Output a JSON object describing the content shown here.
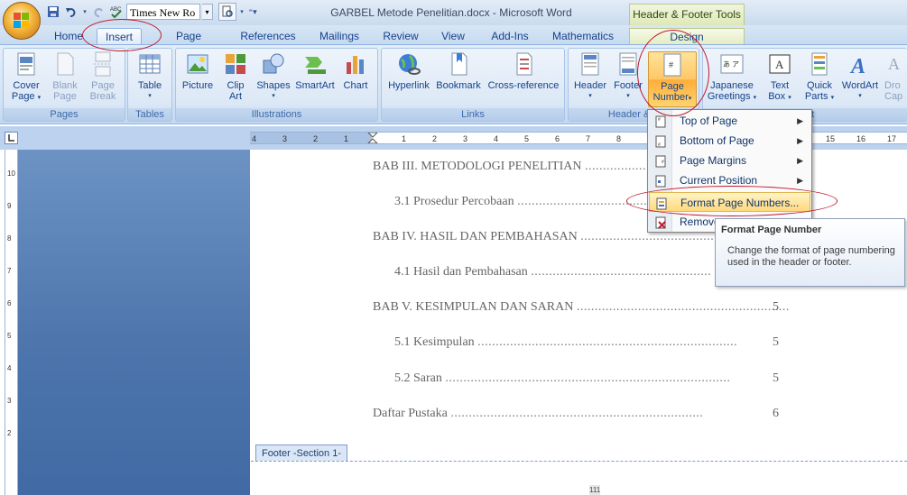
{
  "title_bar": {
    "document_title": "GARBEL Metode Penelitian.docx - Microsoft Word",
    "context_tab_group": "Header & Footer Tools"
  },
  "quick_access": {
    "font_name": "Times New Ro",
    "icons": [
      "save-icon",
      "undo-icon",
      "redo-icon",
      "spelling-icon",
      "print-preview-icon",
      "customize-icon"
    ]
  },
  "tabs": [
    "Home",
    "Insert",
    "Page Layout",
    "References",
    "Mailings",
    "Review",
    "View",
    "Add-Ins",
    "Mathematics",
    "Design"
  ],
  "active_tab": "Insert",
  "ribbon": {
    "groups": [
      {
        "label": "Pages",
        "buttons": [
          "Cover Page",
          "Blank Page",
          "Page Break"
        ]
      },
      {
        "label": "Tables",
        "buttons": [
          "Table"
        ]
      },
      {
        "label": "Illustrations",
        "buttons": [
          "Picture",
          "Clip Art",
          "Shapes",
          "SmartArt",
          "Chart"
        ]
      },
      {
        "label": "Links",
        "buttons": [
          "Hyperlink",
          "Bookmark",
          "Cross-reference"
        ]
      },
      {
        "label": "Header & F",
        "buttons": [
          "Header",
          "Footer",
          "Page Number"
        ]
      },
      {
        "label": "Text",
        "buttons": [
          "Japanese Greetings",
          "Text Box",
          "Quick Parts",
          "WordArt",
          "Dro Cap"
        ]
      }
    ],
    "btn": {
      "cover_1": "Cover",
      "cover_2": "Page",
      "blank_1": "Blank",
      "blank_2": "Page",
      "break_1": "Page",
      "break_2": "Break",
      "table": "Table",
      "picture": "Picture",
      "clipart_1": "Clip",
      "clipart_2": "Art",
      "shapes": "Shapes",
      "smartart": "SmartArt",
      "chart": "Chart",
      "hyperlink": "Hyperlink",
      "bookmark": "Bookmark",
      "crossref": "Cross-reference",
      "header": "Header",
      "footer": "Footer",
      "pagenum_1": "Page",
      "pagenum_2": "Number",
      "japanese_1": "Japanese",
      "japanese_2": "Greetings",
      "textbox_1": "Text",
      "textbox_2": "Box",
      "quickparts_1": "Quick",
      "quickparts_2": "Parts",
      "wordart": "WordArt",
      "dropcap_1": "Dro",
      "dropcap_2": "Cap"
    }
  },
  "ruler": {
    "ticks": [
      "4",
      "3",
      "2",
      "1",
      "1",
      "2",
      "3",
      "4",
      "5",
      "6",
      "7",
      "8",
      "15",
      "16",
      "17"
    ]
  },
  "vertical_ruler": {
    "ticks": [
      "10",
      "9",
      "8",
      "7",
      "6",
      "5",
      "4",
      "3",
      "2"
    ]
  },
  "document": {
    "toc": [
      {
        "text": "BAB III. METODOLOGI PENELITIAN",
        "page": ""
      },
      {
        "text": "3.1 Prosedur Percobaan",
        "page": ""
      },
      {
        "text": "BAB IV. HASIL DAN PEMBAHASAN",
        "page": ""
      },
      {
        "text": "4.1 Hasil dan Pembahasan",
        "page": ""
      },
      {
        "text": "BAB V. KESIMPULAN DAN SARAN",
        "page": "5"
      },
      {
        "text": "5.1 Kesimpulan",
        "page": "5"
      },
      {
        "text": "5.2 Saran",
        "page": "5"
      },
      {
        "text": "Daftar Pustaka",
        "page": "6"
      }
    ],
    "footer_label": "Footer -Section 1-",
    "page_field": "111"
  },
  "menu": {
    "items": [
      {
        "label": "Top of Page",
        "icon": "top-of-page-icon",
        "submenu": true
      },
      {
        "label": "Bottom of Page",
        "icon": "bottom-of-page-icon",
        "submenu": true
      },
      {
        "label": "Page Margins",
        "icon": "page-margins-icon",
        "submenu": true
      },
      {
        "label": "Current Position",
        "icon": "current-position-icon",
        "submenu": true
      },
      {
        "label": "Format Page Numbers...",
        "icon": "format-page-numbers-icon",
        "submenu": false
      },
      {
        "label": "Remove",
        "icon": "remove-page-numbers-icon",
        "submenu": false
      }
    ],
    "highlighted": "Format Page Numbers..."
  },
  "tooltip": {
    "title": "Format Page Number",
    "body": "Change the format of page numbering used in the header or footer."
  },
  "annotation_color": "#c0182c"
}
